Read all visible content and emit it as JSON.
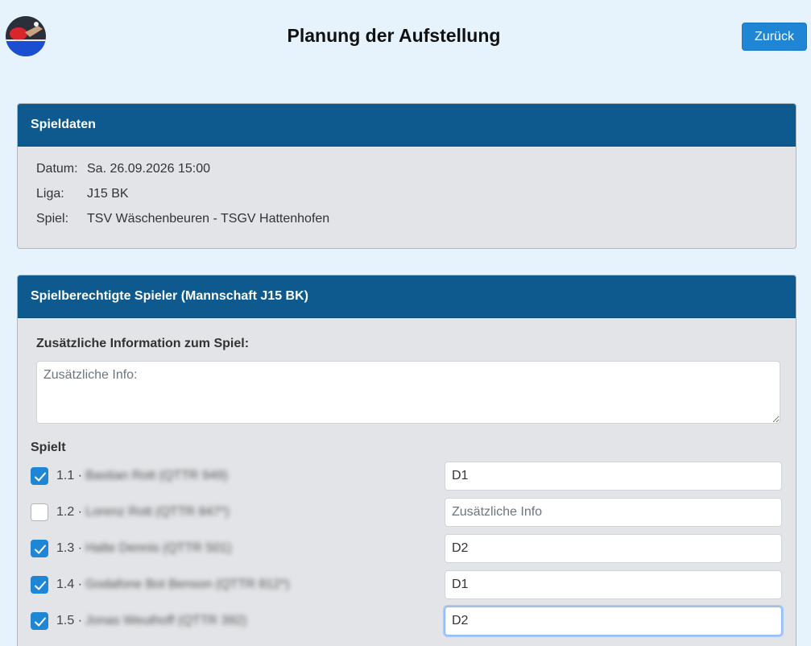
{
  "header": {
    "title": "Planung der Aufstellung",
    "back_label": "Zurück"
  },
  "game_data": {
    "header": "Spieldaten",
    "rows": [
      {
        "label": "Datum:",
        "value": "Sa. 26.09.2026 15:00"
      },
      {
        "label": "Liga:",
        "value": "J15 BK"
      },
      {
        "label": "Spiel:",
        "value": "TSV Wäschenbeuren - TSGV Hattenhofen"
      }
    ]
  },
  "players_section": {
    "header": "Spielberechtigte Spieler (Mannschaft J15 BK)",
    "additional_info_label": "Zusätzliche Information zum Spiel:",
    "additional_info_placeholder": "Zusätzliche Info:",
    "spielt_label": "Spielt",
    "input_placeholder": "Zusätzliche Info",
    "players": [
      {
        "number": "1.1 ·",
        "name": "Bastian Rott (QTTR 949)",
        "checked": true,
        "info": "D1"
      },
      {
        "number": "1.2 ·",
        "name": "Lorenz Rott (QTTR 847*)",
        "checked": false,
        "info": ""
      },
      {
        "number": "1.3 ·",
        "name": "Halte Dennis (QTTR 501)",
        "checked": true,
        "info": "D2"
      },
      {
        "number": "1.4 ·",
        "name": "Godafone Bot Benson (QTTR 812*)",
        "checked": true,
        "info": "D1"
      },
      {
        "number": "1.5 ·",
        "name": "Jonas Weuthoff (QTTR 392)",
        "checked": true,
        "info": "D2"
      }
    ]
  },
  "colors": {
    "accent": "#1f86d6",
    "header_bg": "#0e5a8e",
    "page_bg": "#e6f3fd"
  }
}
